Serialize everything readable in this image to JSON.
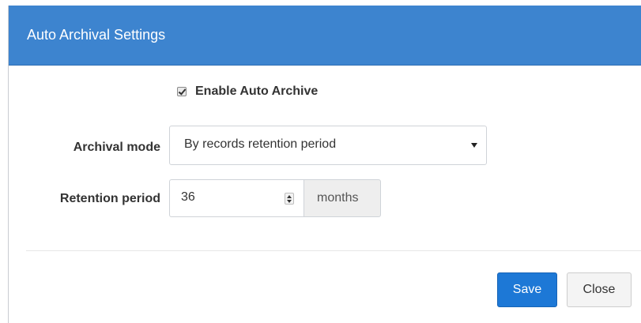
{
  "dialog": {
    "title": "Auto Archival Settings"
  },
  "enable_auto_archive": {
    "label": "Enable Auto Archive",
    "checked": true
  },
  "archival_mode": {
    "label": "Archival mode",
    "selected": "By records retention period"
  },
  "retention_period": {
    "label": "Retention period",
    "value": "36",
    "unit": "months"
  },
  "buttons": {
    "save": "Save",
    "close": "Close"
  },
  "colors": {
    "header": "#3d84cf",
    "primary_button": "#1d78d6"
  }
}
